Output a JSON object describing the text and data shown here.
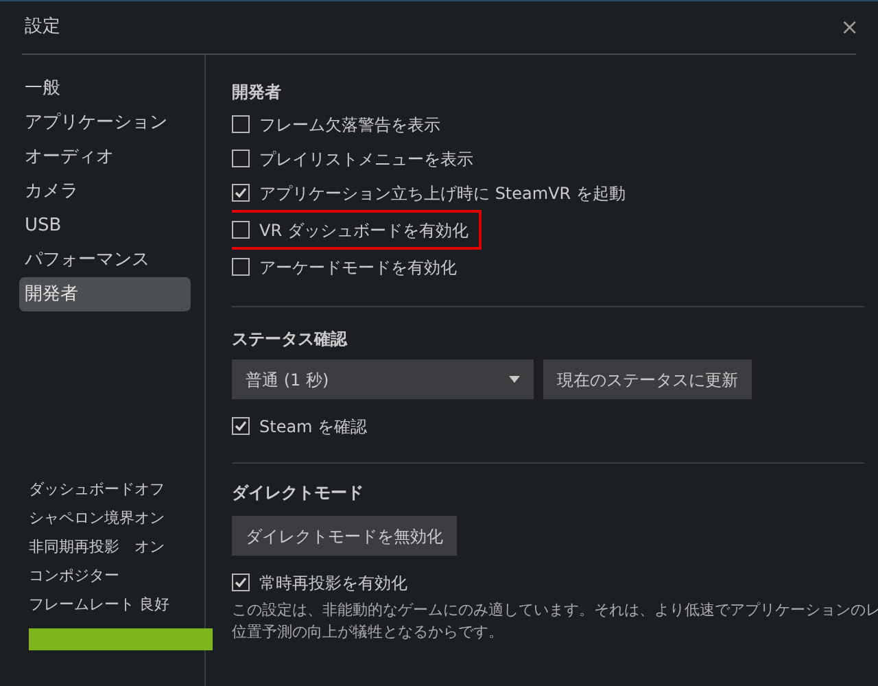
{
  "window": {
    "title": "設定",
    "close": "×"
  },
  "sidebar": {
    "items": [
      {
        "label": "一般",
        "selected": false
      },
      {
        "label": "アプリケーション",
        "selected": false
      },
      {
        "label": "オーディオ",
        "selected": false
      },
      {
        "label": "カメラ",
        "selected": false
      },
      {
        "label": "USB",
        "selected": false
      },
      {
        "label": "パフォーマンス",
        "selected": false
      },
      {
        "label": "開発者",
        "selected": true
      }
    ],
    "status": [
      "ダッシュボードオフ",
      "シャペロン境界オン",
      "非同期再投影　オン",
      "コンポジター",
      "フレームレート 良好"
    ],
    "status_bar": {
      "level": 1
    }
  },
  "developer": {
    "heading": "開発者",
    "options": [
      {
        "label": "フレーム欠落警告を表示",
        "checked": false,
        "highlighted": false
      },
      {
        "label": "プレイリストメニューを表示",
        "checked": false,
        "highlighted": false
      },
      {
        "label": "アプリケーション立ち上げ時に SteamVR を起動",
        "checked": true,
        "highlighted": false
      },
      {
        "label": "VR ダッシュボードを有効化",
        "checked": false,
        "highlighted": true
      },
      {
        "label": "アーケードモードを有効化",
        "checked": false,
        "highlighted": false
      }
    ]
  },
  "status_check": {
    "heading": "ステータス確認",
    "dropdown": "普通 (1 秒)",
    "button": "現在のステータスに更新",
    "option": {
      "label": "Steam を確認",
      "checked": true
    }
  },
  "direct_mode": {
    "heading": "ダイレクトモード",
    "button": "ダイレクトモードを無効化",
    "option": {
      "label": "常時再投影を有効化",
      "checked": true
    },
    "description": [
      "この設定は、非能動的なゲームにのみ適しています。それは、より低速でアプリケーションのレ",
      "位置予測の向上が犠牲となるからです。"
    ]
  }
}
